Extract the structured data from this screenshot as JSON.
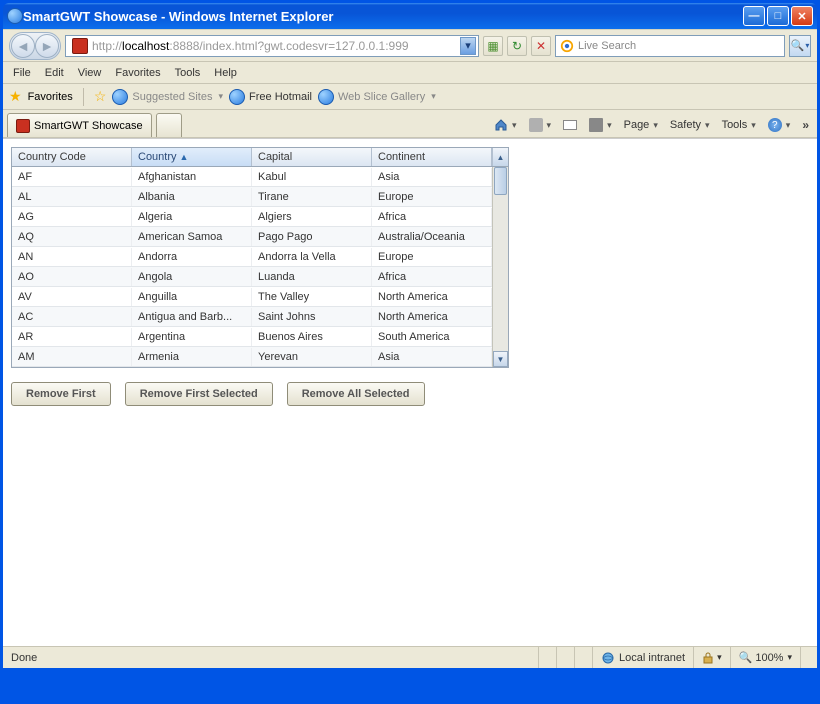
{
  "window": {
    "title": "SmartGWT Showcase - Windows Internet Explorer"
  },
  "address": {
    "url_prefix": "http://",
    "url_host": "localhost",
    "url_port_path": ":8888/index.html?gwt.codesvr=127.0.0.1:999"
  },
  "search": {
    "placeholder": "Live Search"
  },
  "menubar": [
    "File",
    "Edit",
    "View",
    "Favorites",
    "Tools",
    "Help"
  ],
  "favbar": {
    "label": "Favorites",
    "suggested": "Suggested Sites",
    "hotmail": "Free Hotmail",
    "webslice": "Web Slice Gallery"
  },
  "tab": {
    "title": "SmartGWT Showcase"
  },
  "commandbar": {
    "page": "Page",
    "safety": "Safety",
    "tools": "Tools"
  },
  "grid": {
    "headers": [
      "Country Code",
      "Country",
      "Capital",
      "Continent"
    ],
    "sort_column": 1,
    "sort_dir": "asc",
    "rows": [
      [
        "AF",
        "Afghanistan",
        "Kabul",
        "Asia"
      ],
      [
        "AL",
        "Albania",
        "Tirane",
        "Europe"
      ],
      [
        "AG",
        "Algeria",
        "Algiers",
        "Africa"
      ],
      [
        "AQ",
        "American Samoa",
        "Pago Pago",
        "Australia/Oceania"
      ],
      [
        "AN",
        "Andorra",
        "Andorra la Vella",
        "Europe"
      ],
      [
        "AO",
        "Angola",
        "Luanda",
        "Africa"
      ],
      [
        "AV",
        "Anguilla",
        "The Valley",
        "North America"
      ],
      [
        "AC",
        "Antigua and Barb...",
        "Saint Johns",
        "North America"
      ],
      [
        "AR",
        "Argentina",
        "Buenos Aires",
        "South America"
      ],
      [
        "AM",
        "Armenia",
        "Yerevan",
        "Asia"
      ]
    ]
  },
  "buttons": {
    "remove_first": "Remove First",
    "remove_first_selected": "Remove First Selected",
    "remove_all_selected": "Remove All Selected"
  },
  "statusbar": {
    "status": "Done",
    "zone": "Local intranet",
    "zoom": "100%"
  }
}
